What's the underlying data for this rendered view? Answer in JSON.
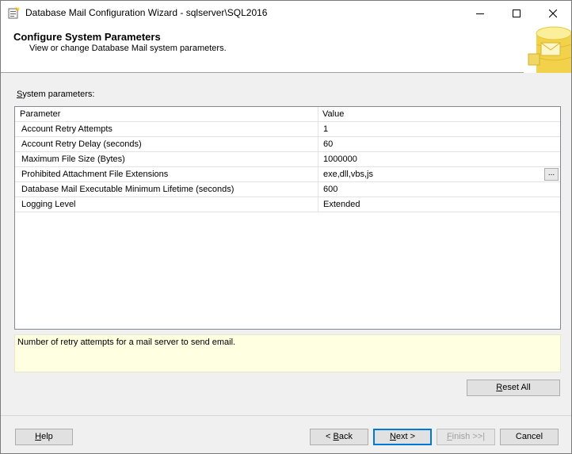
{
  "window": {
    "title": "Database Mail Configuration Wizard - sqlserver\\SQL2016"
  },
  "header": {
    "title": "Configure System Parameters",
    "subtitle": "View or change Database Mail system parameters."
  },
  "section_label": {
    "accel": "S",
    "rest": "ystem parameters:"
  },
  "grid": {
    "columns": [
      "Parameter",
      "Value"
    ],
    "rows": [
      {
        "parameter": "Account Retry Attempts",
        "value": "1"
      },
      {
        "parameter": "Account Retry Delay (seconds)",
        "value": "60"
      },
      {
        "parameter": "Maximum File Size (Bytes)",
        "value": "1000000"
      },
      {
        "parameter": "Prohibited Attachment File Extensions",
        "value": "exe,dll,vbs,js"
      },
      {
        "parameter": "Database Mail Executable Minimum Lifetime (seconds)",
        "value": "600"
      },
      {
        "parameter": "Logging Level",
        "value": "Extended"
      }
    ],
    "ellipsis_label": "..."
  },
  "description": "Number of retry attempts for a mail server to send email.",
  "buttons": {
    "reset_all": {
      "accel": "R",
      "rest": "eset All"
    },
    "help": {
      "accel": "H",
      "rest": "elp"
    },
    "back": {
      "pre": "< ",
      "accel": "B",
      "rest": "ack"
    },
    "next": {
      "accel": "N",
      "rest": "ext >"
    },
    "finish": {
      "accel": "F",
      "rest": "inish >>|"
    },
    "cancel": "Cancel"
  },
  "icons": {
    "app": "wizard-app-icon",
    "header_art": "database-mail-art"
  },
  "colors": {
    "description_bg": "#ffffe1",
    "primary_border": "#0078d7"
  }
}
